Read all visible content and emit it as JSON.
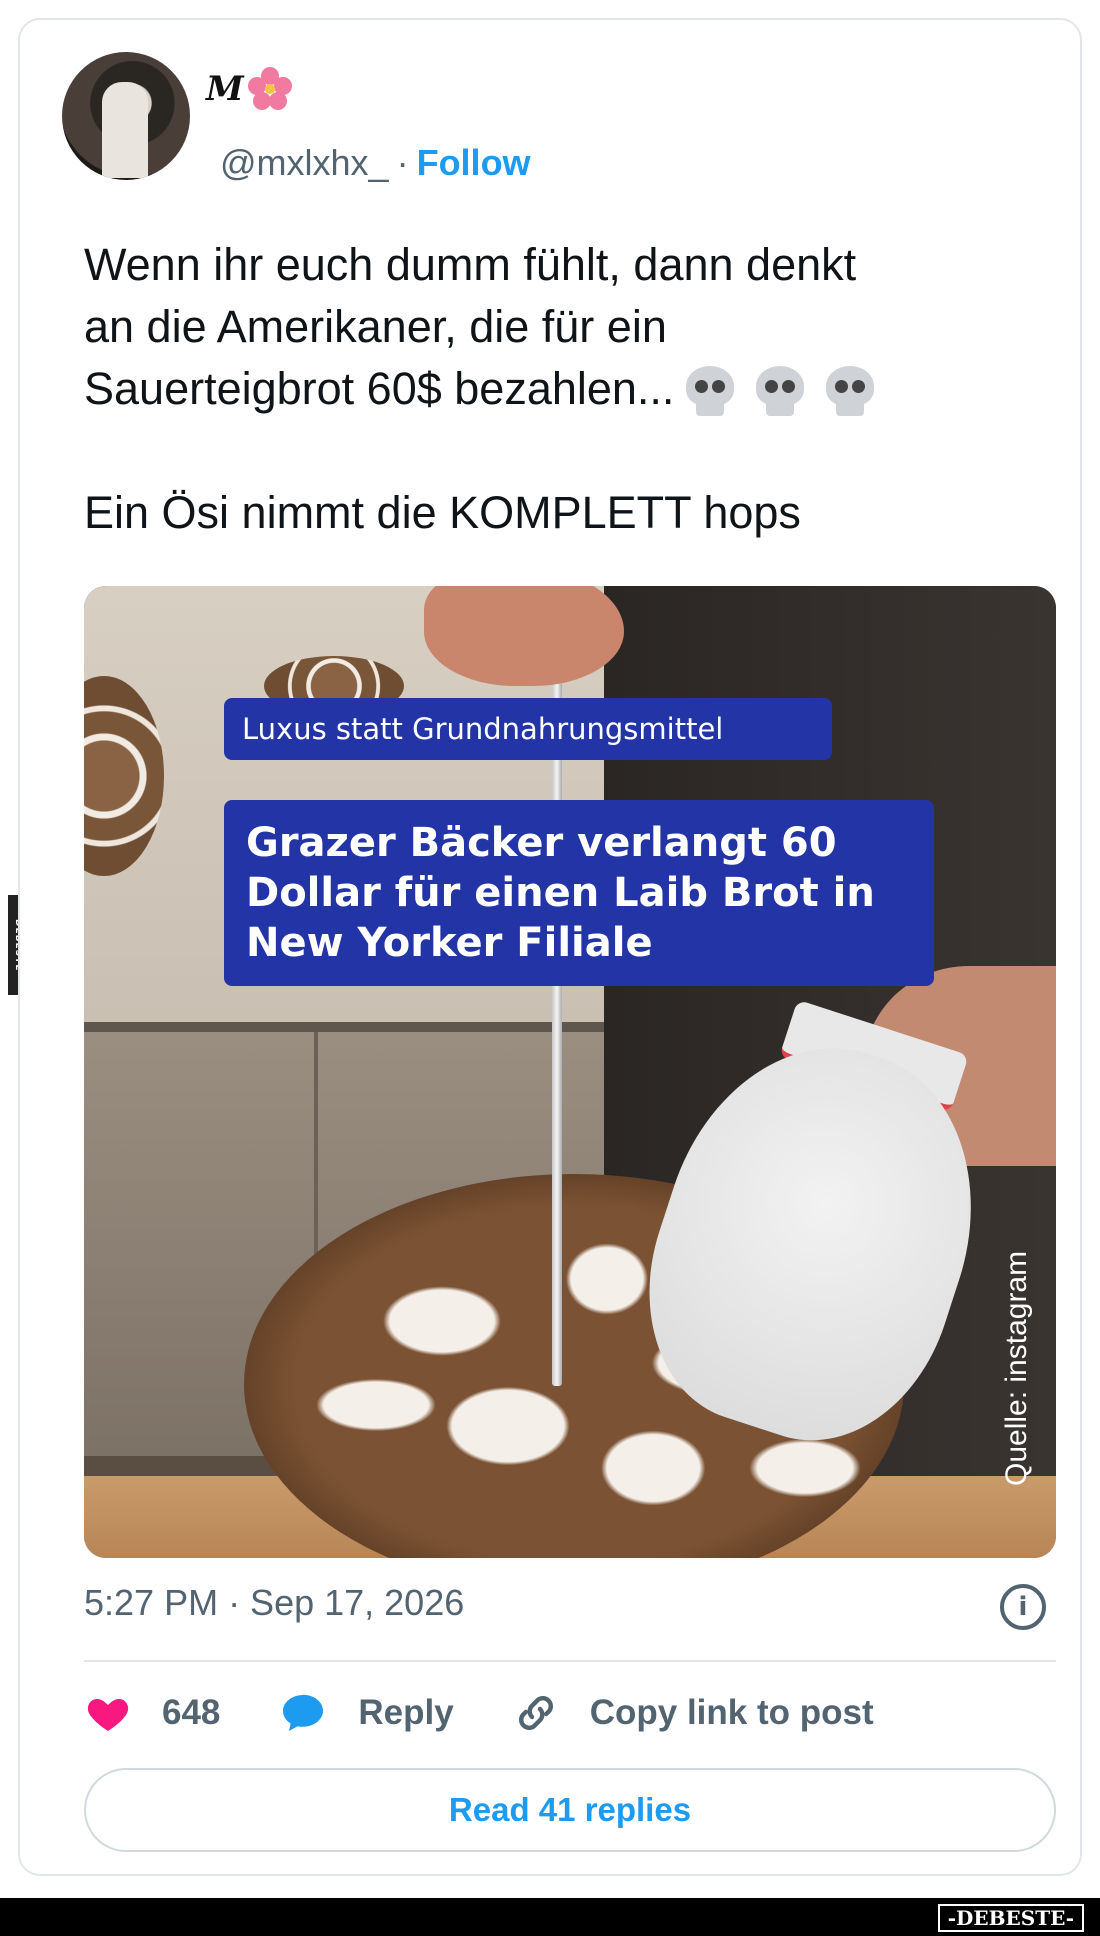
{
  "side_mark": "DEBESTE",
  "post": {
    "display_name": "M",
    "handle": "@mxlxhx_",
    "separator": "·",
    "follow_label": "Follow",
    "text_line1": "Wenn ihr euch dumm fühlt, dann denkt\nan die Amerikaner, die für ein\nSauerteigbrot 60$ bezahlen...",
    "text_line2": "Ein Ösi nimmt die KOMPLETT hops",
    "media": {
      "subtitle": "Luxus statt Grundnahrungsmittel",
      "headline": "Grazer Bäcker verlangt 60 Dollar für einen Laib Brot in New Yorker Filiale",
      "source": "Quelle: instagram"
    },
    "timestamp": "5:27 PM · Sep 17, 2026",
    "info_glyph": "i"
  },
  "actions": {
    "like_count": "648",
    "reply_label": "Reply",
    "copy_label": "Copy link to post"
  },
  "read_replies_label": "Read 41 replies",
  "watermark": "-DEBESTE-",
  "colors": {
    "accent": "#1d9bf0",
    "like": "#f91880",
    "muted": "#536471",
    "badge": "#2335a6"
  }
}
